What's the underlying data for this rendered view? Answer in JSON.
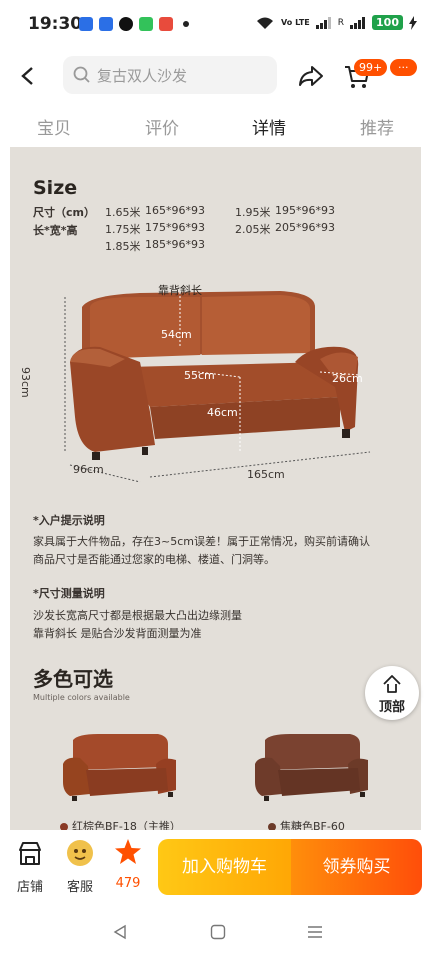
{
  "status_bar": {
    "time": "19:30",
    "net_label": "Vo LTE",
    "battery": "100",
    "app_icon_colors": [
      "#2b6fe6",
      "#2b6fe6",
      "#111111",
      "#33c25a",
      "#e84b3c"
    ]
  },
  "header": {
    "search_placeholder": "复古双人沙发",
    "cart_badge": "99+",
    "more_badge": "···",
    "icons": [
      "back-arrow-icon",
      "search-icon",
      "share-icon",
      "cart-icon",
      "more-icon"
    ]
  },
  "tabs": [
    {
      "label": "宝贝",
      "active": false
    },
    {
      "label": "评价",
      "active": false
    },
    {
      "label": "详情",
      "active": true
    },
    {
      "label": "推荐",
      "active": false
    }
  ],
  "size_section": {
    "title": "Size",
    "row_label_1": "尺寸（cm）",
    "row_label_2": "长*宽*高",
    "col1": [
      {
        "width": "1.65米",
        "dims": "165*96*93"
      },
      {
        "width": "1.75米",
        "dims": "175*96*93"
      },
      {
        "width": "1.85米",
        "dims": "185*96*93"
      }
    ],
    "col2": [
      {
        "width": "1.95米",
        "dims": "195*96*93"
      },
      {
        "width": "2.05米",
        "dims": "205*96*93"
      }
    ],
    "dimension_labels": {
      "back_slope": "靠背斜长",
      "back": "54cm",
      "seat_depth": "55cm",
      "arm": "26cm",
      "seat_height": "46cm",
      "height": "93cm",
      "depth": "96cm",
      "length": "165cm"
    }
  },
  "notes": {
    "delivery_title": "*入户提示说明",
    "delivery_line1": "家具属于大件物品，存在3~5cm误差！属于正常情况，购买前请确认",
    "delivery_line2": "商品尺寸是否能通过您家的电梯、楼道、门洞等。",
    "measure_title": "*尺寸测量说明",
    "measure_line1": "沙发长宽高尺寸都是根据最大凸出边缘测量",
    "measure_line2": "靠背斜长 是贴合沙发背面测量为准"
  },
  "multi_color": {
    "title": "多色可选",
    "subtitle": "Multiple colors available",
    "colors": [
      {
        "label": "红棕色BF-18（主推）",
        "swatch": "#8a3a26"
      },
      {
        "label": "焦糖色BF-60",
        "swatch": "#6b3a28"
      }
    ]
  },
  "back_to_top": {
    "label": "顶部",
    "icon": "arrow-up-icon"
  },
  "bottom_bar": {
    "store": "店铺",
    "service": "客服",
    "favorites": "479",
    "add_to_cart": "加入购物车",
    "buy": "领券购买",
    "accent": "#ff5000"
  },
  "nav_icons": [
    "back-triangle-icon",
    "home-square-icon",
    "menu-lines-icon"
  ]
}
